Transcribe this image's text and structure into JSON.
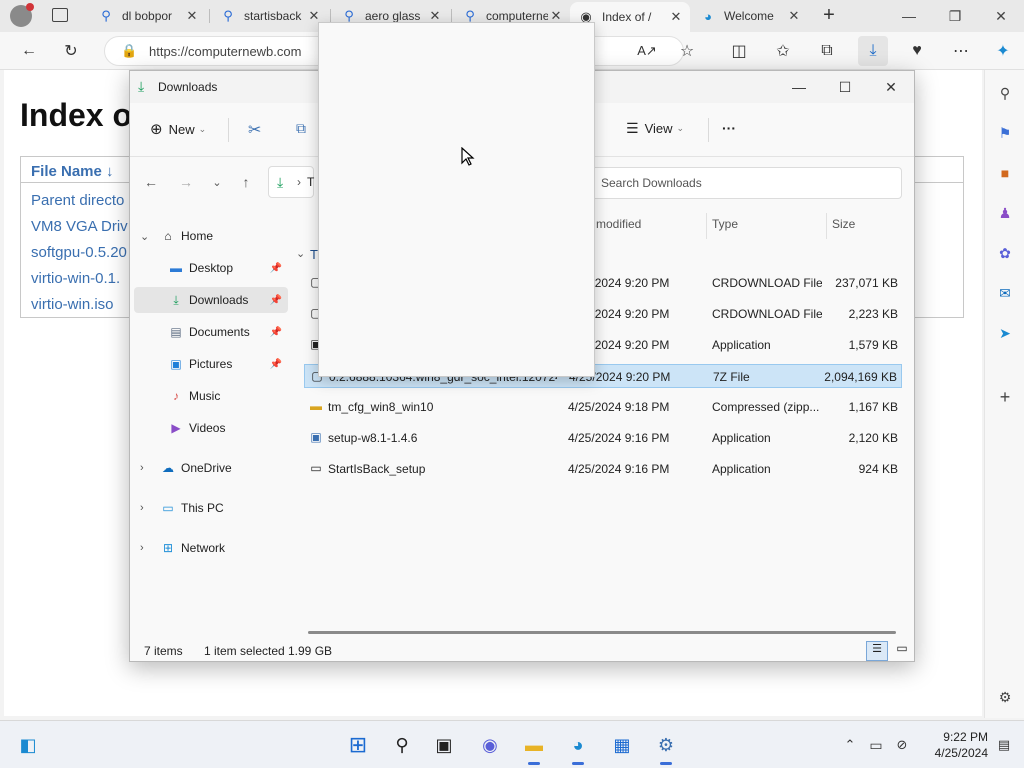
{
  "browser": {
    "tabs": [
      {
        "label": "dl bobpor",
        "icon": "search-icon"
      },
      {
        "label": "startisback",
        "icon": "search-icon"
      },
      {
        "label": "aero glass",
        "icon": "search-icon"
      },
      {
        "label": "computerne",
        "icon": "search-icon"
      },
      {
        "label": "Index of /",
        "icon": "site-icon"
      },
      {
        "label": "Welcome",
        "icon": "edge-icon"
      }
    ],
    "url": "https://computernewb.com"
  },
  "page": {
    "title": "Index o",
    "table_header": "File Name  ↓",
    "links": [
      "Parent directo",
      "VM8 VGA Driv",
      "softgpu-0.5.20",
      "virtio-win-0.1.",
      "virtio-win.iso"
    ]
  },
  "explorer": {
    "title": "Downloads",
    "commands": {
      "new": "New",
      "view": "View",
      "more": "···"
    },
    "breadcrumb_partial": "T",
    "search_placeholder": "Search Downloads",
    "nav": {
      "home": "Home",
      "desktop": "Desktop",
      "downloads": "Downloads",
      "documents": "Documents",
      "pictures": "Pictures",
      "music": "Music",
      "videos": "Videos",
      "onedrive": "OneDrive",
      "thispc": "This PC",
      "network": "Network"
    },
    "columns": {
      "modified": "modified",
      "type": "Type",
      "size": "Size"
    },
    "group_partial": "T",
    "files": [
      {
        "name": "",
        "date": "4/25/2024 9:20 PM",
        "type": "CRDOWNLOAD File",
        "size": "237,071 KB"
      },
      {
        "name": "",
        "date": "4/25/2024 9:20 PM",
        "type": "CRDOWNLOAD File",
        "size": "2,223 KB"
      },
      {
        "name": "",
        "date": "4/25/2024 9:20 PM",
        "type": "Application",
        "size": "1,579 KB"
      },
      {
        "name": "0.2.6888.10364.win8_gdr_soc_intel.120724...",
        "date": "4/25/2024 9:20 PM",
        "type": "7Z File",
        "size": "2,094,169 KB"
      },
      {
        "name": "tm_cfg_win8_win10",
        "date": "4/25/2024 9:18 PM",
        "type": "Compressed (zipp...",
        "size": "1,167 KB"
      },
      {
        "name": "setup-w8.1-1.4.6",
        "date": "4/25/2024 9:16 PM",
        "type": "Application",
        "size": "2,120 KB"
      },
      {
        "name": "StartIsBack_setup",
        "date": "4/25/2024 9:16 PM",
        "type": "Application",
        "size": "924 KB"
      }
    ],
    "status": {
      "count": "7 items",
      "selected": "1 item selected",
      "size": "1.99 GB"
    }
  },
  "taskbar": {
    "time": "9:22 PM",
    "date": "4/25/2024"
  }
}
